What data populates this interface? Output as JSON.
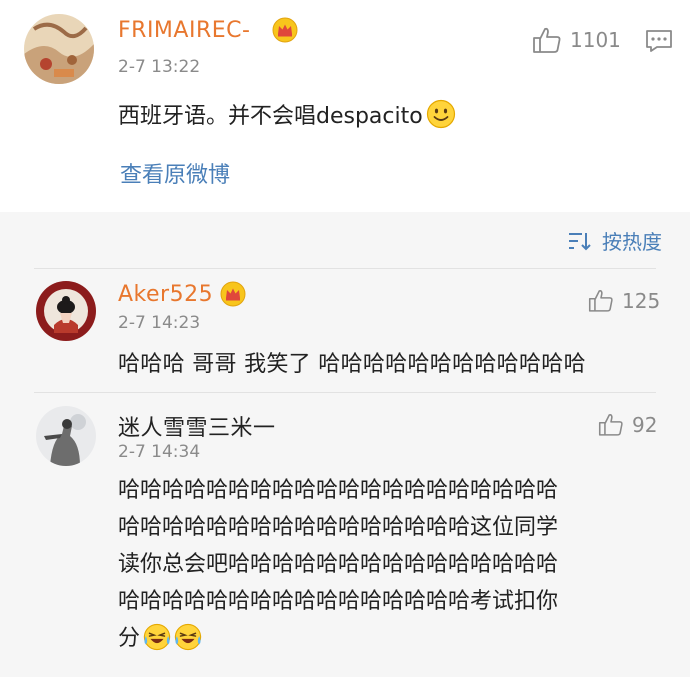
{
  "main_comment": {
    "username": "FRIMAIREC-",
    "timestamp": "2-7 13:22",
    "like_count": "1101",
    "text": "西班牙语。并不会唱despacito",
    "view_original_label": "查看原微博"
  },
  "sort": {
    "label": "按热度"
  },
  "replies": [
    {
      "username": "Aker525",
      "timestamp": "2-7 14:23",
      "like_count": "125",
      "text": "哈哈哈 哥哥 我笑了 哈哈哈哈哈哈哈哈哈哈哈哈"
    },
    {
      "username": "迷人雪雪三米一",
      "timestamp": "2-7 14:34",
      "like_count": "92",
      "lines": [
        "哈哈哈哈哈哈哈哈哈哈哈哈哈哈哈哈哈哈哈哈",
        "哈哈哈哈哈哈哈哈哈哈哈哈哈哈哈哈这位同学",
        "读你总会吧哈哈哈哈哈哈哈哈哈哈哈哈哈哈哈",
        "哈哈哈哈哈哈哈哈哈哈哈哈哈哈哈哈考试扣你",
        "分"
      ]
    }
  ],
  "colors": {
    "username_orange": "#e8772e",
    "link_blue": "#4a7fb8",
    "meta_gray": "#8a8a8a",
    "reply_bg": "#f6f6f6"
  }
}
